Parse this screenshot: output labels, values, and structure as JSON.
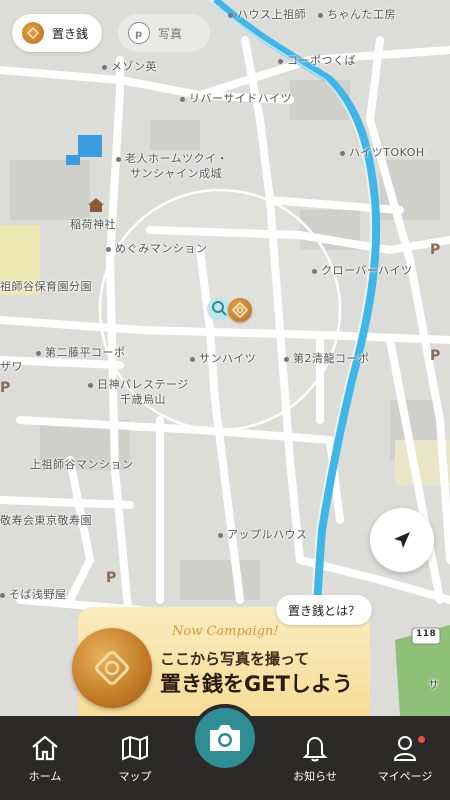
{
  "top_chips": {
    "coin": {
      "label": "置き銭",
      "icon": "coin-icon",
      "active": true
    },
    "photo": {
      "label": "写真",
      "icon": "photo-p-icon",
      "active": false
    }
  },
  "map": {
    "labels": {
      "house_kamisoshigaya": "ハウス上祖師",
      "chanta_kobo": "ちゃんた工房",
      "corpo_tsukuba": "コーポつくば",
      "meson_ei": "メゾン英",
      "riverside_heights": "リバーサイドハイツ",
      "rojin_home_1": "老人ホームツクイ・",
      "rojin_home_2": "サンシャイン成城",
      "heights_tokoh": "ハイツTOKOH",
      "inari_jinja": "稲荷神社",
      "megumi_mansion": "めぐみマンション",
      "clover_heights": "クローバーハイツ",
      "hoikuen": "祖師谷保育園分園",
      "zawa": "ザワ",
      "daini_fujihei": "第二藤平コーポ",
      "sun_heights": "サンハイツ",
      "daini_seiryo": "第2清龍コーポ",
      "nisshin_palace_1": "日神パレステージ",
      "nisshin_palace_2": "千歳烏山",
      "kamisoshigaya_mansion": "上祖師谷マンション",
      "keiju_en": "敬寿会東京敬寿園",
      "apple_house": "アップルハウス",
      "soba_asanoya": "そば浅野屋",
      "sa": "サ"
    },
    "parking_label": "P",
    "route_number": "118"
  },
  "locate_button": {
    "icon": "navigation-arrow-icon"
  },
  "whatis_button": {
    "label": "置き銭とは？"
  },
  "campaign": {
    "tag": "Now Campaign!",
    "line1": "ここから写真を撮って",
    "line2": "置き銭をGETしよう"
  },
  "tabbar": {
    "home": {
      "label": "ホーム",
      "icon": "home-icon"
    },
    "map": {
      "label": "マップ",
      "icon": "map-icon"
    },
    "camera": {
      "icon": "camera-icon"
    },
    "notifications": {
      "label": "お知らせ",
      "icon": "bell-icon"
    },
    "mypage": {
      "label": "マイページ",
      "icon": "user-icon",
      "badge": true
    }
  },
  "colors": {
    "river": "#3fb6e6",
    "accent": "#2f8d94",
    "coin": "#c27a26",
    "tabbar": "#2b2a29"
  }
}
